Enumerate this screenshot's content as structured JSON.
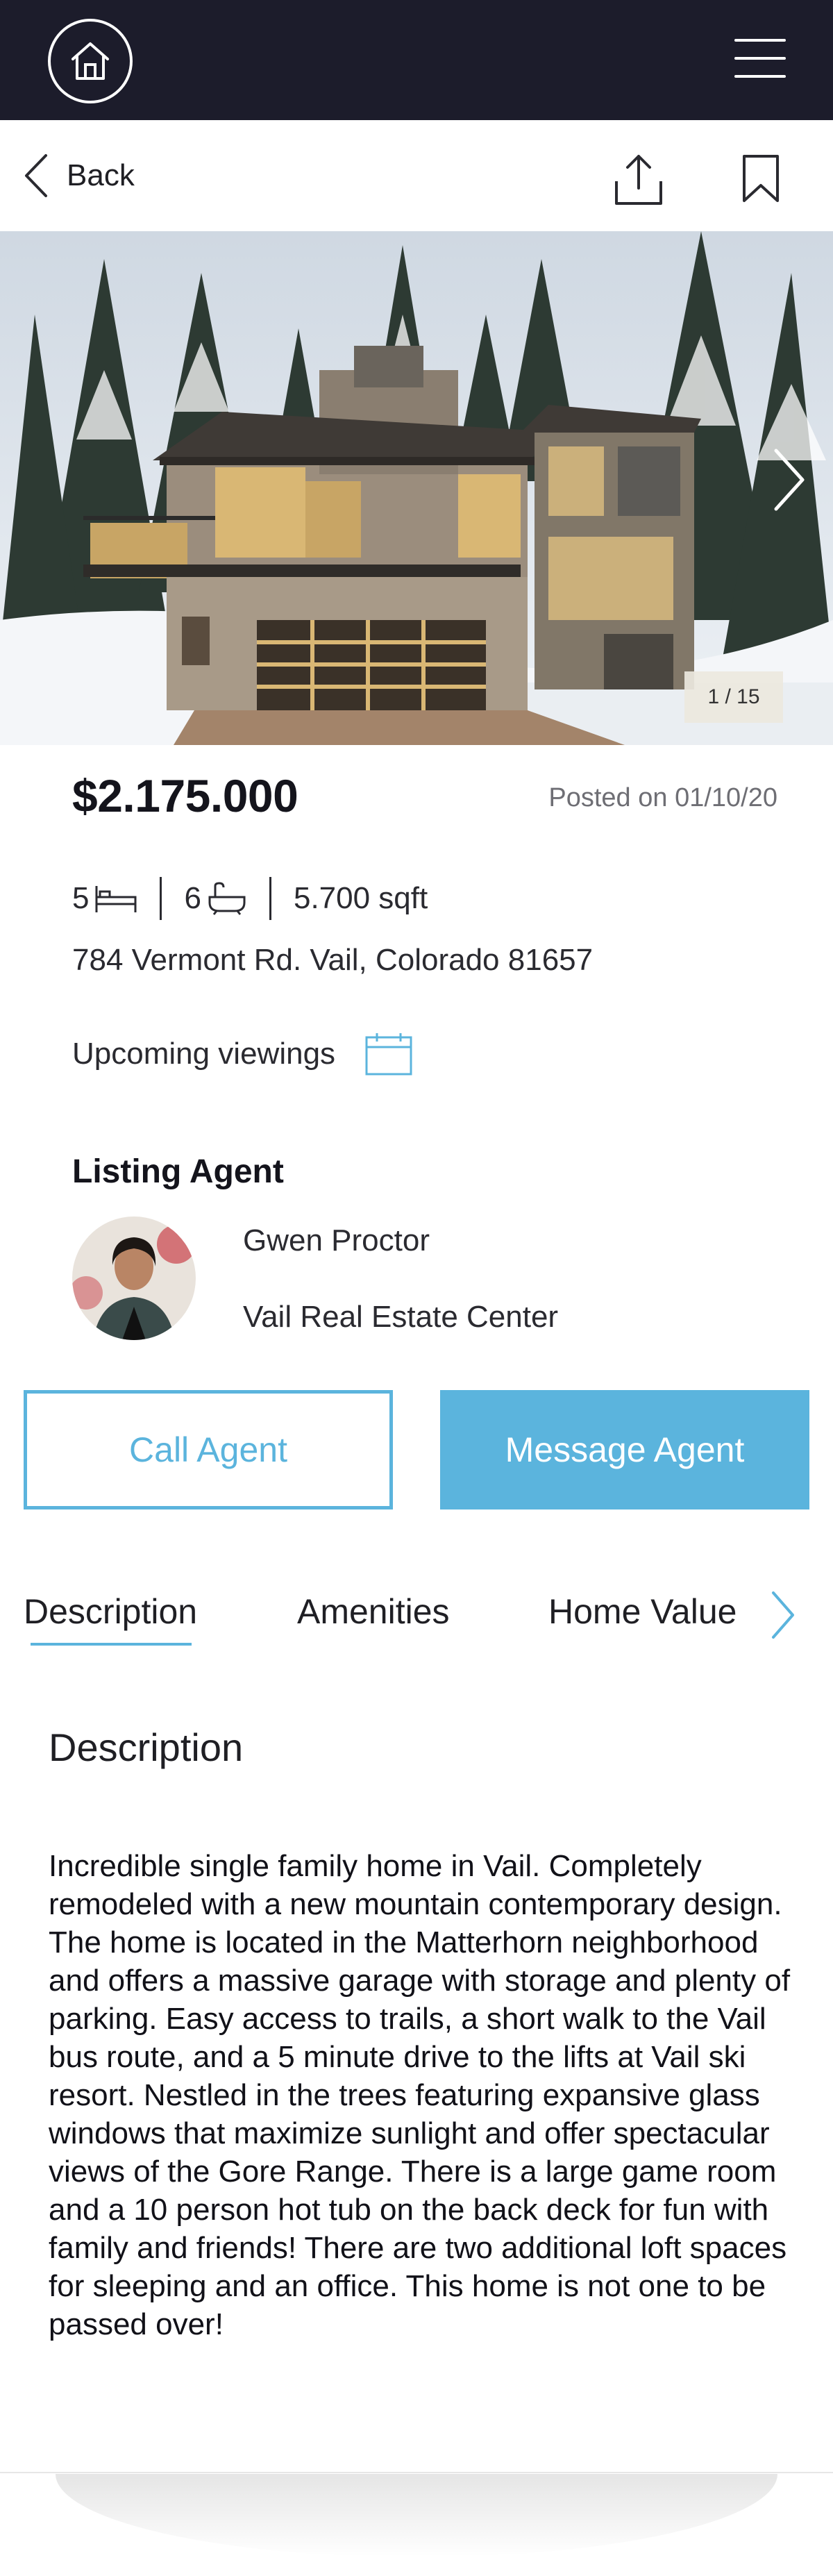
{
  "header": {
    "home_icon": "home-icon",
    "menu_icon": "hamburger-menu-icon"
  },
  "nav": {
    "back_label": "Back",
    "share_icon": "share-icon",
    "bookmark_icon": "bookmark-icon"
  },
  "gallery": {
    "counter": "1 / 15",
    "next_icon": "chevron-right-icon"
  },
  "listing": {
    "price": "$2.175.000",
    "posted": "Posted on 01/10/20",
    "beds": "5",
    "baths": "6",
    "area": "5.700 sqft",
    "address": "784 Vermont Rd.  Vail, Colorado 81657",
    "viewings_label": "Upcoming viewings"
  },
  "agent": {
    "heading": "Listing Agent",
    "name": "Gwen Proctor",
    "office": "Vail Real Estate Center",
    "call_label": "Call Agent",
    "message_label": "Message Agent"
  },
  "tabs": [
    {
      "label": "Description",
      "active": true
    },
    {
      "label": "Amenities",
      "active": false
    },
    {
      "label": "Home Value",
      "active": false
    }
  ],
  "description": {
    "title": "Description",
    "body": "Incredible single family home in Vail.  Completely remodeled with a new mountain contemporary design.  The home is located in the Matterhorn neighborhood and offers a massive garage with storage and plenty of parking.  Easy access to trails, a short walk to the Vail bus route, and a 5 minute drive to the lifts at Vail ski resort.  Nestled in the trees featuring expansive glass windows that maximize sunlight and offer spectacular views of the Gore Range.  There is a large game room and a 10 person hot tub on the back deck for fun with family and friends!  There are two additional loft spaces for sleeping and an office.  This home is not one to be passed over!"
  },
  "colors": {
    "topbar": "#1c1c2b",
    "accent": "#5bb4dd",
    "text": "#1f1f24",
    "muted": "#6e6e74"
  }
}
